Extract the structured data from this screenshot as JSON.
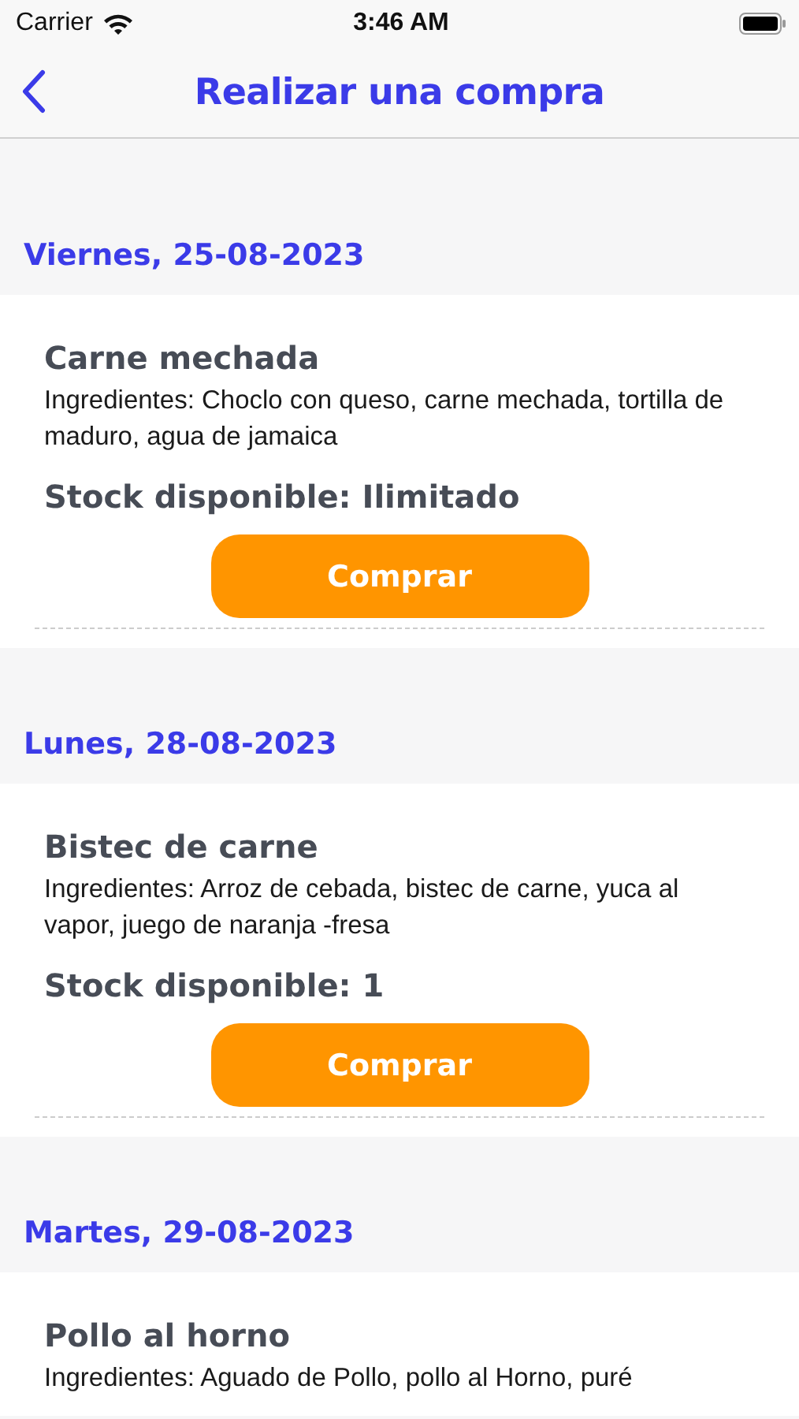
{
  "status_bar": {
    "carrier": "Carrier",
    "time": "3:46 AM"
  },
  "nav": {
    "title": "Realizar una compra"
  },
  "days": [
    {
      "date": "Viernes, 25-08-2023",
      "meal": {
        "name": "Carne mechada",
        "ingredients": "Ingredientes: Choclo con queso, carne mechada, tortilla de maduro, agua de jamaica",
        "stock": "Stock disponible: Ilimitado",
        "button": "Comprar"
      }
    },
    {
      "date": "Lunes, 28-08-2023",
      "meal": {
        "name": "Bistec de carne",
        "ingredients": "Ingredientes: Arroz de cebada, bistec de carne, yuca al vapor, juego de naranja -fresa",
        "stock": "Stock disponible: 1",
        "button": "Comprar"
      }
    },
    {
      "date": "Martes, 29-08-2023",
      "meal": {
        "name": "Pollo al horno",
        "ingredients": "Ingredientes: Aguado de Pollo, pollo al Horno, puré"
      }
    }
  ]
}
